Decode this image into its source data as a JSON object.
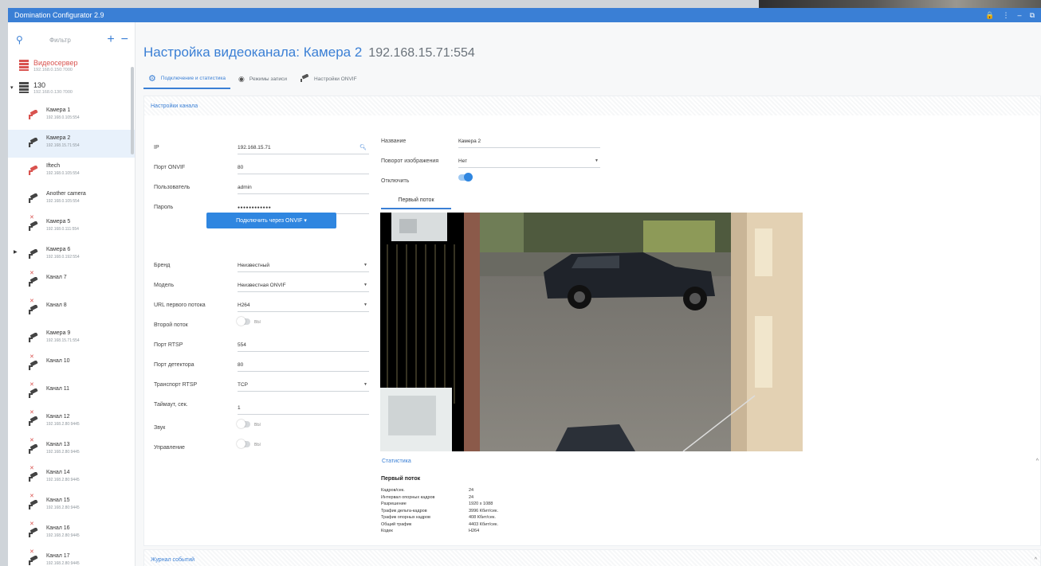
{
  "window": {
    "title": "Domination Configurator 2.9",
    "controls": [
      "🔒",
      "⋮",
      "–",
      "⧉"
    ]
  },
  "sidebar": {
    "filter_placeholder": "Фильтр",
    "add": "+",
    "remove": "−",
    "servers": [
      {
        "name": "Видеосервер",
        "sub": "192.168.0.150:7000",
        "status": "error"
      },
      {
        "name": "130",
        "sub": "192.168.0.130:7000",
        "status": "ok"
      }
    ],
    "cameras": [
      {
        "label": "Камера 1",
        "addr": "192.168.0.105:554",
        "icon_color": "#d9534f",
        "error": false
      },
      {
        "label": "Камера 2",
        "addr": "192.168.15.71:554",
        "icon_color": "#444444",
        "error": false,
        "selected": true
      },
      {
        "label": "Iftech",
        "addr": "192.168.0.105:554",
        "icon_color": "#d9534f",
        "error": false
      },
      {
        "label": "Another camera",
        "addr": "192.168.0.105:554",
        "icon_color": "#444444",
        "error": false
      },
      {
        "label": "Камера 5",
        "addr": "192.168.0.111:554",
        "icon_color": "#444444",
        "error": true
      },
      {
        "label": "Камера 6",
        "addr": "192.168.0.192:554",
        "icon_color": "#444444",
        "error": false,
        "expandable": true
      },
      {
        "label": "Канал 7",
        "addr": "",
        "icon_color": "#444444",
        "error": true
      },
      {
        "label": "Канал 8",
        "addr": "",
        "icon_color": "#444444",
        "error": true
      },
      {
        "label": "Камера 9",
        "addr": "192.168.15.71:554",
        "icon_color": "#444444",
        "error": false
      },
      {
        "label": "Канал 10",
        "addr": "",
        "icon_color": "#444444",
        "error": true
      },
      {
        "label": "Канал 11",
        "addr": "",
        "icon_color": "#444444",
        "error": true
      },
      {
        "label": "Канал 12",
        "addr": "192.168.2.80:9445",
        "icon_color": "#444444",
        "error": true
      },
      {
        "label": "Канал 13",
        "addr": "192.168.2.80:9445",
        "icon_color": "#444444",
        "error": true
      },
      {
        "label": "Канал 14",
        "addr": "192.168.2.80:9445",
        "icon_color": "#444444",
        "error": true
      },
      {
        "label": "Канал 15",
        "addr": "192.168.2.80:9445",
        "icon_color": "#444444",
        "error": true
      },
      {
        "label": "Канал 16",
        "addr": "192.168.2.80:9445",
        "icon_color": "#444444",
        "error": true
      },
      {
        "label": "Канал 17",
        "addr": "192.168.2.80:9445",
        "icon_color": "#444444",
        "error": true
      }
    ]
  },
  "main": {
    "title": "Настройка видеоканала: Камера 2",
    "title_addr": "192.168.15.71:554",
    "tabs": [
      {
        "label": "Подключение и статистика",
        "icon": "gear-icon",
        "active": true
      },
      {
        "label": "Режимы записи",
        "icon": "record-icon",
        "active": false
      },
      {
        "label": "Настройки ONVIF",
        "icon": "camera-icon",
        "active": false
      }
    ],
    "channel_panel_title": "Настройки канала",
    "left_form": {
      "ip_label": "IP",
      "ip_value": "192.168.15.71",
      "onvif_port_label": "Порт ONVIF",
      "onvif_port_value": "80",
      "user_label": "Пользователь",
      "user_value": "admin",
      "password_label": "Пароль",
      "password_value": "●●●●●●●●●●●●",
      "connect_button": "Подключить через ONVIF ▾",
      "brand_label": "Бренд",
      "brand_value": "Неизвестный",
      "model_label": "Модель",
      "model_value": "Неизвестная ONVIF",
      "url_label": "URL первого потока",
      "url_value": "H264",
      "second_stream_label": "Второй поток",
      "second_stream_state": "ВЫ",
      "rtsp_port_label": "Порт RTSP",
      "rtsp_port_value": "554",
      "detector_port_label": "Порт детектора",
      "detector_port_value": "80",
      "transport_label": "Транспорт RTSP",
      "transport_value": "TCP",
      "timeout_label": "Таймаут, сек.",
      "timeout_value": "1",
      "sound_label": "Звук",
      "sound_state": "ВЫ",
      "control_label": "Управление",
      "control_state": "ВЫ"
    },
    "right_form": {
      "name_label": "Название",
      "name_value": "Камера 2",
      "rotate_label": "Поворот изображения",
      "rotate_value": "Нет",
      "disable_label": "Отключить"
    },
    "stream_tab": "Первый поток",
    "stats_title": "Статистика",
    "stats_sub": "Первый поток",
    "stats": [
      {
        "k": "Кадров/сек.",
        "v": "24"
      },
      {
        "k": "Интервал опорных кадров",
        "v": "24"
      },
      {
        "k": "Разрешение",
        "v": "1920 x 1088"
      },
      {
        "k": "Трафик дельта-кадров",
        "v": "3996 Кбит/сек."
      },
      {
        "k": "Трафик опорных кадров",
        "v": "408 Кбит/сек."
      },
      {
        "k": "Общий трафик",
        "v": "4403 Кбит/сек."
      },
      {
        "k": "Кодек",
        "v": "H264"
      }
    ],
    "log_title": "Журнал событий",
    "collapse_glyph": "^"
  }
}
